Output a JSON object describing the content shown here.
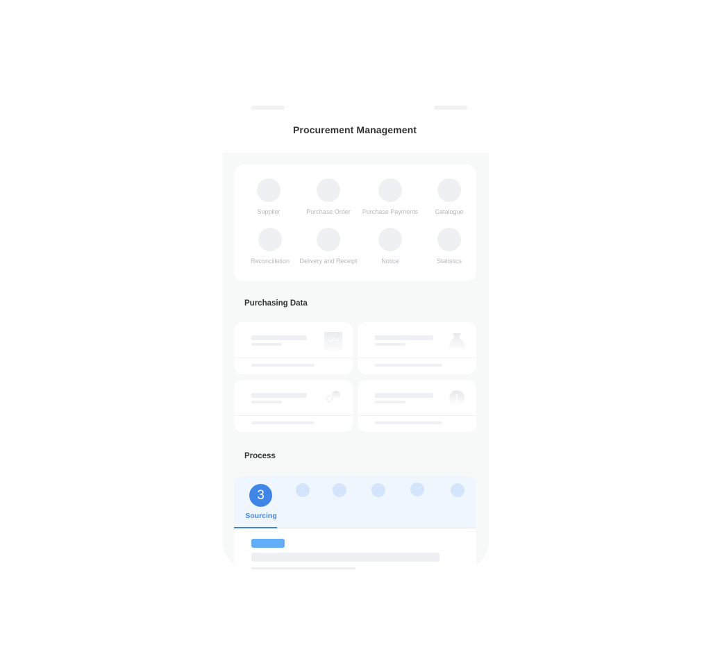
{
  "header": {
    "title": "Procurement Management"
  },
  "menu": {
    "items": [
      {
        "label": "Supplier",
        "icon": "supplier-icon"
      },
      {
        "label": "Purchase Order",
        "icon": "purchase-order-icon"
      },
      {
        "label": "Purchase Payments",
        "icon": "purchase-payments-icon"
      },
      {
        "label": "Catalogue",
        "icon": "catalogue-icon"
      },
      {
        "label": "Reconciliation",
        "icon": "reconciliation-icon"
      },
      {
        "label": "Delivery and Receipt",
        "icon": "delivery-receipt-icon"
      },
      {
        "label": "Notice",
        "icon": "notice-icon"
      },
      {
        "label": "Statistics",
        "icon": "statistics-icon"
      }
    ]
  },
  "purchasing_data": {
    "title": "Purchasing Data",
    "cards": [
      {
        "icon": "checklist-document-icon"
      },
      {
        "icon": "money-bag-icon"
      },
      {
        "icon": "coins-icon"
      },
      {
        "icon": "currency-coin-icon"
      }
    ]
  },
  "process": {
    "title": "Process",
    "active_step": {
      "number": "3",
      "label": "Sourcing"
    },
    "total_steps": 6,
    "colors": {
      "active": "#3f86e6",
      "inactive": "#d3e4fb",
      "tag": "#62aef8"
    }
  }
}
